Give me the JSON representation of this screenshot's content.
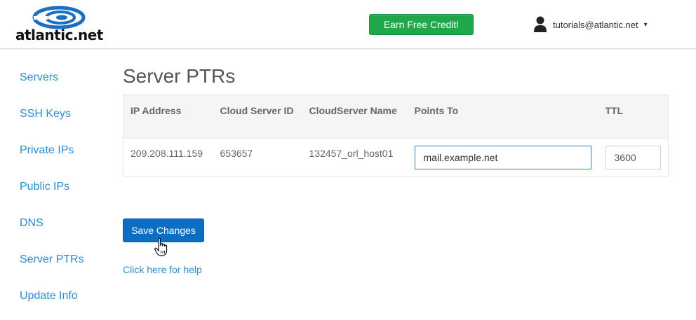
{
  "header": {
    "logo_text": "atlantic.net",
    "earn_button": "Earn Free Credit!",
    "user_email": "tutorials@atlantic.net",
    "user_menu_caret": "▾"
  },
  "sidebar": {
    "items": [
      {
        "label": "Servers"
      },
      {
        "label": "SSH Keys"
      },
      {
        "label": "Private IPs"
      },
      {
        "label": "Public IPs"
      },
      {
        "label": "DNS"
      },
      {
        "label": "Server PTRs"
      },
      {
        "label": "Update Info"
      }
    ]
  },
  "main": {
    "title": "Server PTRs",
    "table": {
      "headers": {
        "ip": "IP Address",
        "cloud_id": "Cloud Server ID",
        "cloud_name": "CloudServer Name",
        "points_to": "Points To",
        "ttl": "TTL"
      },
      "rows": [
        {
          "ip": "209.208.111.159",
          "cloud_id": "653657",
          "cloud_name": "132457_orl_host01",
          "points_to": "mail.example.net",
          "ttl": "3600"
        }
      ]
    },
    "save_button": "Save Changes",
    "help_link": "Click here for help"
  },
  "colors": {
    "brand_blue": "#2a8fd0",
    "earn_green": "#1fa84a",
    "save_blue": "#0a6ec4"
  },
  "icons": [
    "atlantic-logo-swirl",
    "user-icon",
    "hand-cursor-icon"
  ]
}
